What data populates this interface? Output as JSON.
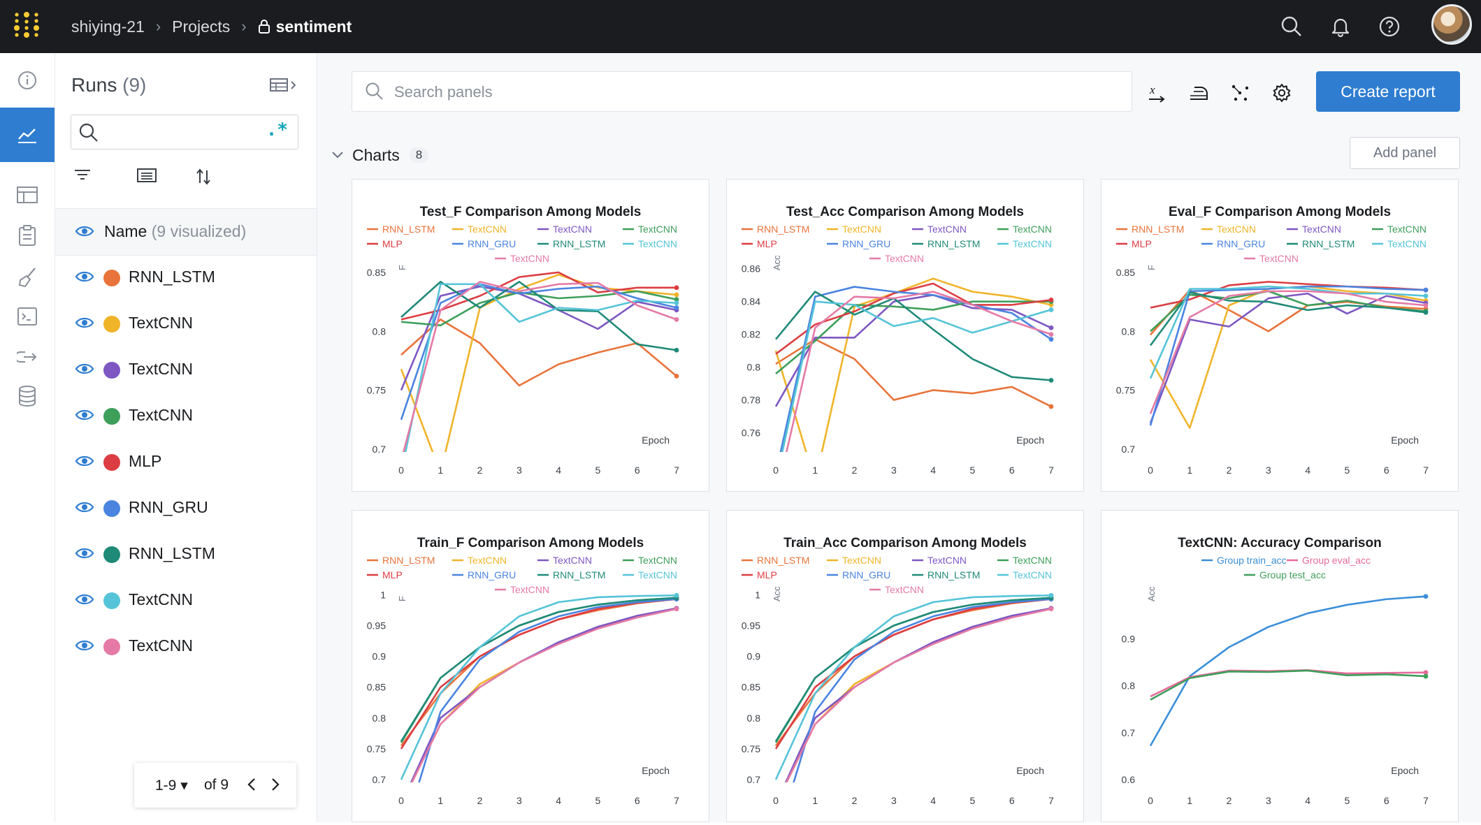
{
  "breadcrumb": {
    "user": "shiying-21",
    "projects": "Projects",
    "project": "sentiment"
  },
  "runs_panel": {
    "title": "Runs",
    "count": "(9)",
    "name_header": "Name",
    "visualized": "(9 visualized)",
    "search_value": "",
    "pagination": {
      "range": "1-9",
      "of": "of 9"
    }
  },
  "runs": [
    {
      "name": "RNN_LSTM",
      "color": "#e8743b"
    },
    {
      "name": "TextCNN",
      "color": "#f0b429"
    },
    {
      "name": "TextCNN",
      "color": "#7e57c2"
    },
    {
      "name": "TextCNN",
      "color": "#3d9f5a"
    },
    {
      "name": "MLP",
      "color": "#dc3d42"
    },
    {
      "name": "RNN_GRU",
      "color": "#4a84e0"
    },
    {
      "name": "RNN_LSTM",
      "color": "#1f8a78"
    },
    {
      "name": "TextCNN",
      "color": "#55c4d8"
    },
    {
      "name": "TextCNN",
      "color": "#e57aa6"
    }
  ],
  "toolbar": {
    "search_placeholder": "Search panels",
    "create_report": "Create report"
  },
  "section": {
    "title": "Charts",
    "count": "8",
    "add_panel": "Add panel"
  },
  "chart_data": [
    {
      "type": "line",
      "title": "Test_F Comparison Among Models",
      "xlabel": "Epoch",
      "ylabel": "F",
      "x": [
        0,
        1,
        2,
        3,
        4,
        5,
        6,
        7
      ],
      "ylim": [
        0.7,
        0.86
      ],
      "yticks": [
        0.7,
        0.75,
        0.8,
        0.85
      ],
      "series": [
        {
          "name": "RNN_LSTM",
          "values": [
            0.78,
            0.81,
            0.79,
            0.754,
            0.772,
            0.782,
            0.79,
            0.762
          ]
        },
        {
          "name": "TextCNN",
          "values": [
            0.768,
            0.68,
            0.82,
            0.836,
            0.848,
            0.837,
            0.834,
            0.831
          ]
        },
        {
          "name": "TextCNN",
          "values": [
            0.75,
            0.83,
            0.838,
            0.832,
            0.818,
            0.802,
            0.825,
            0.818
          ]
        },
        {
          "name": "TextCNN",
          "values": [
            0.808,
            0.805,
            0.824,
            0.833,
            0.828,
            0.83,
            0.834,
            0.827
          ]
        },
        {
          "name": "MLP",
          "values": [
            0.81,
            0.818,
            0.83,
            0.846,
            0.85,
            0.833,
            0.837,
            0.837
          ]
        },
        {
          "name": "RNN_GRU",
          "values": [
            0.725,
            0.824,
            0.84,
            0.832,
            0.836,
            0.838,
            0.828,
            0.82
          ]
        },
        {
          "name": "RNN_LSTM",
          "values": [
            0.812,
            0.842,
            0.82,
            0.842,
            0.818,
            0.817,
            0.789,
            0.784
          ]
        },
        {
          "name": "TextCNN",
          "values": [
            0.68,
            0.84,
            0.84,
            0.808,
            0.82,
            0.818,
            0.826,
            0.824
          ]
        },
        {
          "name": "TextCNN",
          "values": [
            0.69,
            0.818,
            0.842,
            0.834,
            0.84,
            0.841,
            0.822,
            0.81
          ]
        }
      ]
    },
    {
      "type": "line",
      "title": "Test_Acc Comparison Among Models",
      "xlabel": "Epoch",
      "ylabel": "Acc",
      "x": [
        0,
        1,
        2,
        3,
        4,
        5,
        6,
        7
      ],
      "ylim": [
        0.75,
        0.865
      ],
      "yticks": [
        0.76,
        0.78,
        0.8,
        0.82,
        0.84,
        0.86
      ],
      "series": [
        {
          "name": "RNN_LSTM",
          "values": [
            0.802,
            0.817,
            0.805,
            0.78,
            0.786,
            0.784,
            0.788,
            0.776
          ]
        },
        {
          "name": "TextCNN",
          "values": [
            0.81,
            0.73,
            0.837,
            0.845,
            0.854,
            0.846,
            0.843,
            0.838
          ]
        },
        {
          "name": "TextCNN",
          "values": [
            0.776,
            0.818,
            0.818,
            0.84,
            0.844,
            0.836,
            0.835,
            0.824
          ]
        },
        {
          "name": "TextCNN",
          "values": [
            0.796,
            0.816,
            0.838,
            0.837,
            0.835,
            0.84,
            0.84,
            0.84
          ]
        },
        {
          "name": "MLP",
          "values": [
            0.808,
            0.826,
            0.834,
            0.845,
            0.851,
            0.838,
            0.838,
            0.841
          ]
        },
        {
          "name": "RNN_GRU",
          "values": [
            0.735,
            0.843,
            0.849,
            0.846,
            0.844,
            0.838,
            0.833,
            0.817
          ]
        },
        {
          "name": "RNN_LSTM",
          "values": [
            0.817,
            0.846,
            0.832,
            0.842,
            0.823,
            0.805,
            0.794,
            0.792
          ]
        },
        {
          "name": "TextCNN",
          "values": [
            0.73,
            0.84,
            0.838,
            0.825,
            0.83,
            0.821,
            0.828,
            0.835
          ]
        },
        {
          "name": "TextCNN",
          "values": [
            0.72,
            0.824,
            0.843,
            0.842,
            0.846,
            0.838,
            0.828,
            0.82
          ]
        }
      ]
    },
    {
      "type": "line",
      "title": "Eval_F Comparison Among Models",
      "xlabel": "Epoch",
      "ylabel": "F",
      "x": [
        0,
        1,
        2,
        3,
        4,
        5,
        6,
        7
      ],
      "ylim": [
        0.7,
        0.86
      ],
      "yticks": [
        0.7,
        0.75,
        0.8,
        0.85
      ],
      "series": [
        {
          "name": "RNN_LSTM",
          "values": [
            0.797,
            0.835,
            0.818,
            0.8,
            0.822,
            0.825,
            0.821,
            0.819
          ]
        },
        {
          "name": "TextCNN",
          "values": [
            0.776,
            0.718,
            0.822,
            0.836,
            0.838,
            0.834,
            0.832,
            0.826
          ]
        },
        {
          "name": "TextCNN",
          "values": [
            0.722,
            0.81,
            0.804,
            0.828,
            0.832,
            0.815,
            0.83,
            0.824
          ]
        },
        {
          "name": "TextCNN",
          "values": [
            0.8,
            0.831,
            0.828,
            0.834,
            0.822,
            0.826,
            0.82,
            0.817
          ]
        },
        {
          "name": "MLP",
          "values": [
            0.82,
            0.827,
            0.839,
            0.842,
            0.84,
            0.838,
            0.837,
            0.835
          ]
        },
        {
          "name": "RNN_GRU",
          "values": [
            0.72,
            0.834,
            0.835,
            0.836,
            0.838,
            0.838,
            0.836,
            0.835
          ]
        },
        {
          "name": "RNN_LSTM",
          "values": [
            0.788,
            0.833,
            0.826,
            0.825,
            0.818,
            0.822,
            0.82,
            0.816
          ]
        },
        {
          "name": "TextCNN",
          "values": [
            0.76,
            0.836,
            0.836,
            0.838,
            0.836,
            0.832,
            0.832,
            0.83
          ]
        },
        {
          "name": "TextCNN",
          "values": [
            0.73,
            0.812,
            0.83,
            0.834,
            0.834,
            0.832,
            0.825,
            0.822
          ]
        }
      ]
    },
    {
      "type": "line",
      "title": "Train_F Comparison Among Models",
      "xlabel": "Epoch",
      "ylabel": "F",
      "x": [
        0,
        1,
        2,
        3,
        4,
        5,
        6,
        7
      ],
      "ylim": [
        0.7,
        1.005
      ],
      "yticks": [
        0.7,
        0.75,
        0.8,
        0.85,
        0.9,
        0.95,
        1
      ],
      "series": [
        {
          "name": "RNN_LSTM",
          "values": [
            0.755,
            0.84,
            0.9,
            0.935,
            0.96,
            0.975,
            0.986,
            0.993
          ]
        },
        {
          "name": "TextCNN",
          "values": [
            0.66,
            0.79,
            0.855,
            0.89,
            0.922,
            0.948,
            0.965,
            0.978
          ]
        },
        {
          "name": "TextCNN",
          "values": [
            0.66,
            0.8,
            0.85,
            0.89,
            0.923,
            0.948,
            0.966,
            0.978
          ]
        },
        {
          "name": "TextCNN",
          "values": [
            0.76,
            0.865,
            0.915,
            0.95,
            0.972,
            0.984,
            0.991,
            0.995
          ]
        },
        {
          "name": "MLP",
          "values": [
            0.75,
            0.85,
            0.9,
            0.935,
            0.96,
            0.977,
            0.987,
            0.993
          ]
        },
        {
          "name": "RNN_GRU",
          "values": [
            0.6,
            0.81,
            0.895,
            0.94,
            0.965,
            0.98,
            0.988,
            0.993
          ]
        },
        {
          "name": "RNN_LSTM",
          "values": [
            0.762,
            0.865,
            0.915,
            0.95,
            0.972,
            0.984,
            0.991,
            0.995
          ]
        },
        {
          "name": "TextCNN",
          "values": [
            0.7,
            0.84,
            0.915,
            0.965,
            0.988,
            0.996,
            0.998,
            0.999
          ]
        },
        {
          "name": "TextCNN",
          "values": [
            0.66,
            0.79,
            0.85,
            0.89,
            0.92,
            0.945,
            0.963,
            0.977
          ]
        }
      ]
    },
    {
      "type": "line",
      "title": "Train_Acc Comparison Among Models",
      "xlabel": "Epoch",
      "ylabel": "Acc",
      "x": [
        0,
        1,
        2,
        3,
        4,
        5,
        6,
        7
      ],
      "ylim": [
        0.7,
        1.005
      ],
      "yticks": [
        0.7,
        0.75,
        0.8,
        0.85,
        0.9,
        0.95,
        1
      ],
      "series": [
        {
          "name": "RNN_LSTM",
          "values": [
            0.755,
            0.84,
            0.9,
            0.935,
            0.96,
            0.975,
            0.986,
            0.993
          ]
        },
        {
          "name": "TextCNN",
          "values": [
            0.66,
            0.79,
            0.855,
            0.89,
            0.922,
            0.948,
            0.965,
            0.978
          ]
        },
        {
          "name": "TextCNN",
          "values": [
            0.66,
            0.8,
            0.85,
            0.89,
            0.923,
            0.948,
            0.966,
            0.978
          ]
        },
        {
          "name": "TextCNN",
          "values": [
            0.76,
            0.865,
            0.915,
            0.95,
            0.972,
            0.984,
            0.991,
            0.995
          ]
        },
        {
          "name": "MLP",
          "values": [
            0.75,
            0.85,
            0.9,
            0.935,
            0.96,
            0.977,
            0.987,
            0.993
          ]
        },
        {
          "name": "RNN_GRU",
          "values": [
            0.6,
            0.81,
            0.895,
            0.94,
            0.965,
            0.98,
            0.988,
            0.993
          ]
        },
        {
          "name": "RNN_LSTM",
          "values": [
            0.762,
            0.865,
            0.915,
            0.95,
            0.972,
            0.984,
            0.991,
            0.995
          ]
        },
        {
          "name": "TextCNN",
          "values": [
            0.7,
            0.84,
            0.915,
            0.965,
            0.988,
            0.996,
            0.998,
            0.999
          ]
        },
        {
          "name": "TextCNN",
          "values": [
            0.66,
            0.79,
            0.85,
            0.89,
            0.92,
            0.945,
            0.963,
            0.977
          ]
        }
      ]
    },
    {
      "type": "line",
      "title": "TextCNN: Accuracy Comparison",
      "xlabel": "Epoch",
      "ylabel": "Acc",
      "x": [
        0,
        1,
        2,
        3,
        4,
        5,
        6,
        7
      ],
      "ylim": [
        0.6,
        1.0
      ],
      "yticks": [
        0.6,
        0.7,
        0.8,
        0.9
      ],
      "series": [
        {
          "name": "Group train_acc",
          "color": "#3b8fd9",
          "values": [
            0.672,
            0.82,
            0.882,
            0.925,
            0.954,
            0.972,
            0.984,
            0.99
          ]
        },
        {
          "name": "Group eval_acc",
          "color": "#e76a9b",
          "values": [
            0.777,
            0.818,
            0.832,
            0.831,
            0.833,
            0.826,
            0.827,
            0.828
          ]
        },
        {
          "name": "Group test_acc",
          "color": "#3d9f5a",
          "values": [
            0.77,
            0.816,
            0.83,
            0.829,
            0.832,
            0.822,
            0.824,
            0.82
          ]
        }
      ]
    }
  ]
}
